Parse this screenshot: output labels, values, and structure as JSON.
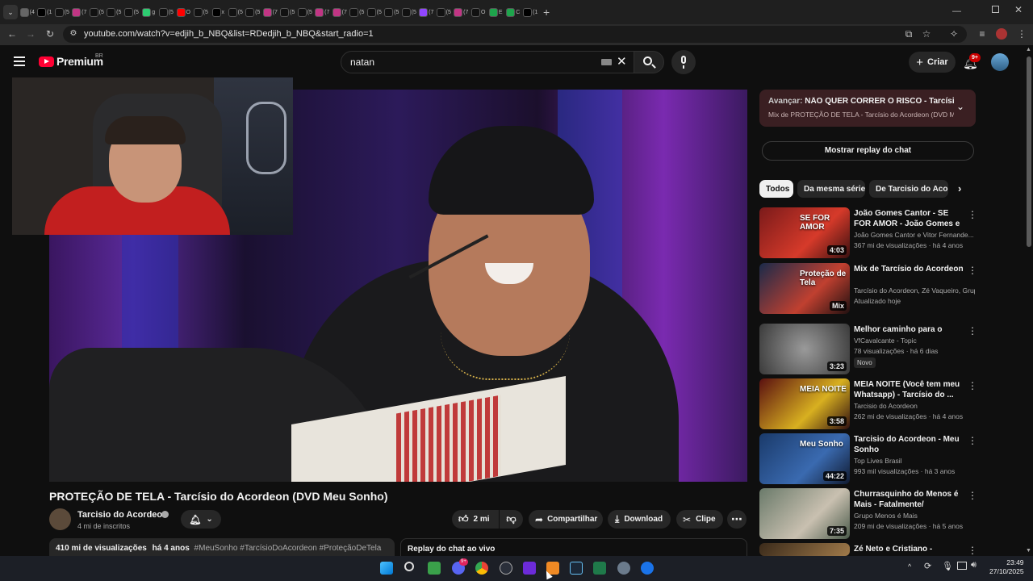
{
  "browser": {
    "tabs": [
      "(4",
      "(1",
      "(5",
      "(7",
      "(5",
      "(5",
      "(5",
      "g",
      "(5",
      "O",
      "(5",
      "x",
      "(5",
      "(5",
      "(7",
      "(5",
      "(5",
      "(7",
      "(7",
      "(5",
      "(5",
      "(5",
      "(5",
      "(7",
      "(5",
      "(7",
      "O",
      "E",
      "C",
      "(1"
    ],
    "url": "youtube.com/watch?v=edjih_b_NBQ&list=RDedjih_b_NBQ&start_radio=1"
  },
  "header": {
    "logo": "Premium",
    "region": "BR",
    "search_value": "natan",
    "create_label": "Criar",
    "notifications": "9+"
  },
  "video": {
    "title": "PROTEÇÃO DE TELA - Tarcísio do Acordeon (DVD Meu Sonho)",
    "channel": "Tarcisio do Acordeon",
    "subscribers": "4 mi de inscritos",
    "likes": "2 mi",
    "share_label": "Compartilhar",
    "download_label": "Download",
    "clip_label": "Clipe",
    "views": "410 mi de visualizações",
    "age": "há 4 anos",
    "hashtags": "#MeuSonho #TarcísioDoAcordeon #ProteçãoDeTela",
    "chat_replay": "Replay do chat ao vivo"
  },
  "sidebar": {
    "up_next_prefix": "Avançar:",
    "up_next_title": "NÃO QUER CORRER O RISCO - Tarcísio do...",
    "up_next_sub": "Mix de PROTEÇÃO DE TELA - Tarcísio do Acordeon (DVD Me...",
    "show_chat": "Mostrar replay do chat",
    "chips": [
      "Todos",
      "Da mesma série",
      "De Tarcisio do Acordeon"
    ],
    "recommendations": [
      {
        "title": "João Gomes Cantor - SE FOR AMOR - João Gomes e Vitor ...",
        "channel": "João Gomes Cantor",
        "channel_extra": "e Vitor Fernande...",
        "meta": "367 mi de visualizações · há 4 anos",
        "duration": "4:03",
        "thumb_text": "SE FOR AMOR"
      },
      {
        "title": "Mix de Tarcísio do Acordeon",
        "channel": "Tarcísio do Acordeon, Zé Vaqueiro, Grup...",
        "channel_extra": "",
        "meta": "Atualizado hoje",
        "duration": "Mix",
        "thumb_text": "Proteção de Tela"
      },
      {
        "title": "Melhor caminho para o pecador",
        "channel": "VfCavalcante - Topic",
        "channel_extra": "",
        "meta": "78 visualizações · há 6 dias",
        "duration": "3:23",
        "badge": "Novo",
        "thumb_text": ""
      },
      {
        "title": "MEIA NOITE (Você tem meu Whatsapp) - Tarcísio do ...",
        "channel": "Tarcisio do Acordeon",
        "channel_extra": "",
        "meta": "262 mi de visualizações · há 4 anos",
        "duration": "3:58",
        "thumb_text": "MEIA NOITE"
      },
      {
        "title": "Tarcisio do Acordeon - Meu Sonho",
        "channel": "Top Lives Brasil",
        "channel_extra": "",
        "meta": "993 mil visualizações · há 3 anos",
        "duration": "44:22",
        "thumb_text": "Meu Sonho"
      },
      {
        "title": "Churrasquinho do Menos é Mais - Fatalmente/ Separação...",
        "channel": "Grupo Menos é Mais",
        "channel_extra": "",
        "meta": "209 mi de visualizações · há 5 anos",
        "duration": "7:35",
        "thumb_text": ""
      },
      {
        "title": "Zé Neto e Cristiano - LARGADO",
        "channel": "",
        "channel_extra": "",
        "meta": "",
        "duration": "",
        "thumb_text": ""
      }
    ]
  },
  "taskbar": {
    "time": "23:49",
    "date": "27/10/2025",
    "discord_badge": "9+"
  },
  "colors": {
    "background": "#0f0f0f",
    "youtube_red": "#ff0033",
    "upnext_bg": "#3a1f22",
    "chip_active": "#f1f1f1"
  }
}
